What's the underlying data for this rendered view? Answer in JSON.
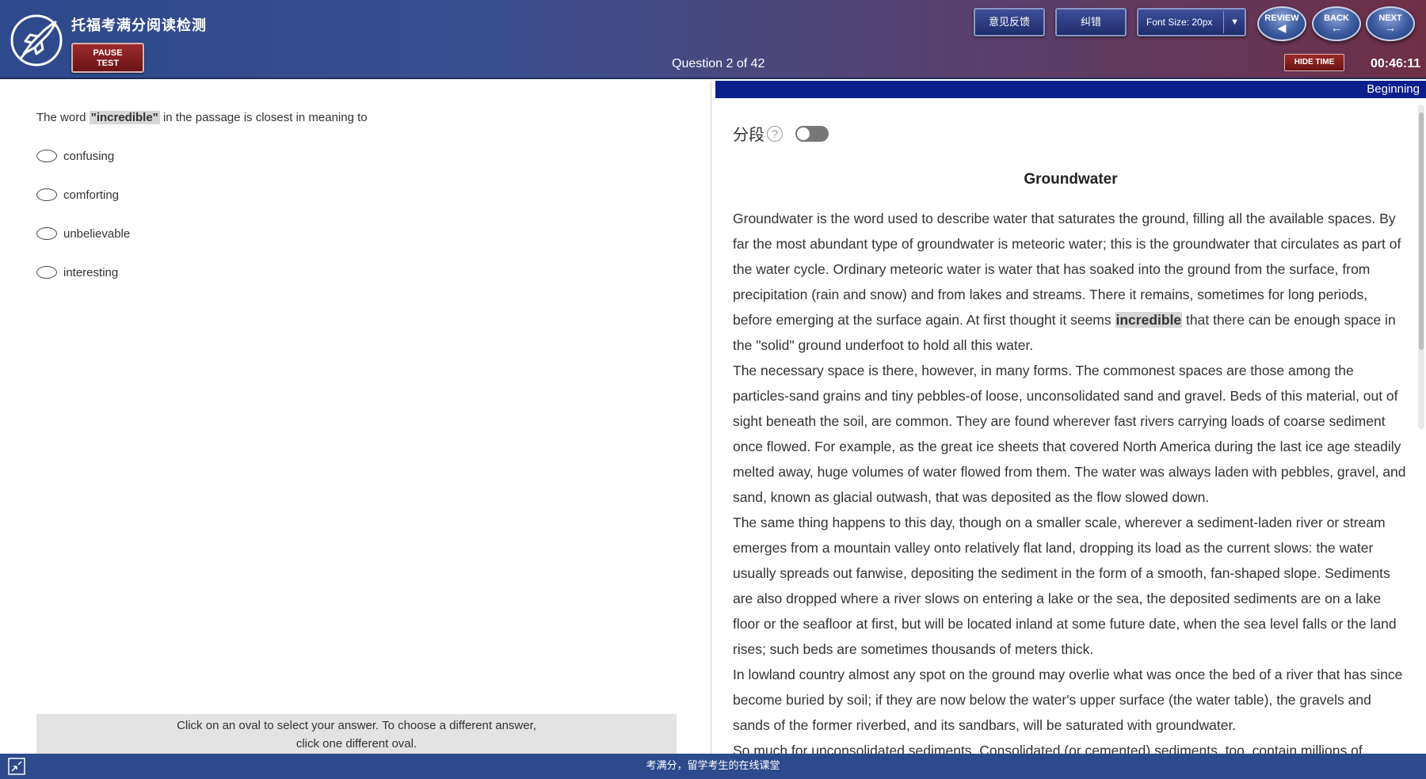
{
  "header": {
    "app_title": "托福考满分阅读检测",
    "pause_label_line1": "PAUSE",
    "pause_label_line2": "TEST",
    "question_count": "Question 2 of 42",
    "feedback_label": "意见反馈",
    "correction_label": "纠错",
    "font_size_label": "Font Size: 20px",
    "review_label": "REVIEW",
    "back_label": "BACK",
    "next_label": "NEXT",
    "hide_time_label": "HIDE TIME",
    "timer": "00:46:11"
  },
  "question": {
    "prefix": "The word ",
    "word": "\"incredible\"",
    "suffix": " in the passage is closest in meaning to",
    "options": [
      "confusing",
      "comforting",
      "unbelievable",
      "interesting"
    ],
    "instruction_line1": "Click on an oval to select your answer. To choose a different answer,",
    "instruction_line2": "click one different oval."
  },
  "passage": {
    "position_label": "Beginning",
    "segment_label": "分段",
    "help_glyph": "?",
    "title": "Groundwater",
    "p1_before": "Groundwater is the word used to describe water that saturates the ground, filling all the available spaces. By far the most abundant type of groundwater is meteoric water; this is the groundwater that circulates as part of the water cycle. Ordinary meteoric water is water that has soaked into the ground from the surface, from precipitation (rain and snow) and from lakes and streams. There it remains, sometimes for long periods, before emerging at the surface again. At first thought it seems ",
    "p1_highlight": "incredible",
    "p1_after": " that there can be enough space in the \"solid\" ground underfoot to hold all this water.",
    "p2": "The necessary space is there, however, in many forms. The commonest spaces are those among the particles-sand grains and tiny pebbles-of loose, unconsolidated sand and gravel. Beds of this material, out of sight beneath the soil, are common. They are found wherever fast rivers carrying loads of coarse sediment once flowed. For example, as the great ice sheets that covered North America during the last ice age steadily melted away, huge volumes of water flowed from them. The water was always laden with pebbles, gravel, and sand, known as glacial outwash, that was deposited as the flow slowed down.",
    "p3": "The same thing happens to this day, though on a smaller scale, wherever a sediment-laden river or stream emerges from a mountain valley onto relatively flat land, dropping its load as the current slows: the water usually spreads out fanwise, depositing the sediment in the form of a smooth, fan-shaped slope. Sediments are also dropped where a river slows on entering a lake or the sea, the deposited sediments are on a lake floor or the seafloor at first, but will be located inland at some future date, when the sea level falls or the land rises; such beds are sometimes thousands of meters thick.",
    "p4": "In lowland country almost any spot on the ground may overlie what was once the bed of a river that has since become buried by soil; if they are now below the water's upper surface (the water table), the gravels and sands of the former riverbed, and its sandbars, will be saturated with groundwater.",
    "p5": "So much for unconsolidated sediments. Consolidated (or cemented) sediments, too, contain millions of"
  },
  "footer": {
    "text": "考满分，留学考生的在线课堂"
  }
}
